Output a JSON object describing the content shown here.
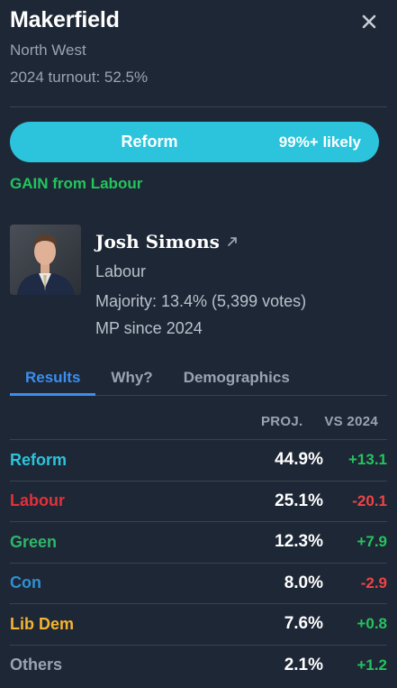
{
  "constituency": {
    "name": "Makerfield",
    "region": "North West",
    "turnout": "2024 turnout: 52.5%"
  },
  "prediction": {
    "party": "Reform",
    "likelihood": "99%+ likely",
    "status": "GAIN from Labour",
    "bar_color": "#2bc4dc"
  },
  "mp": {
    "name": "Josh Simons",
    "party": "Labour",
    "majority": "Majority: 13.4% (5,399 votes)",
    "since": "MP since 2024"
  },
  "tabs": [
    "Results",
    "Why?",
    "Demographics"
  ],
  "table": {
    "headers": {
      "proj": "PROJ.",
      "vs": "VS 2024"
    },
    "rows": [
      {
        "party": "Reform",
        "proj": "44.9%",
        "change": "+13.1",
        "color": "#2bc4dc",
        "change_color": "#22c55e"
      },
      {
        "party": "Labour",
        "proj": "25.1%",
        "change": "-20.1",
        "color": "#e4303a",
        "change_color": "#ef4444"
      },
      {
        "party": "Green",
        "proj": "12.3%",
        "change": "+7.9",
        "color": "#2fb56a",
        "change_color": "#22c55e"
      },
      {
        "party": "Con",
        "proj": "8.0%",
        "change": "-2.9",
        "color": "#2f8fd0",
        "change_color": "#ef4444"
      },
      {
        "party": "Lib Dem",
        "proj": "7.6%",
        "change": "+0.8",
        "color": "#f5b531",
        "change_color": "#22c55e"
      },
      {
        "party": "Others",
        "proj": "2.1%",
        "change": "+1.2",
        "color": "#9aa3b2",
        "change_color": "#22c55e"
      }
    ]
  }
}
